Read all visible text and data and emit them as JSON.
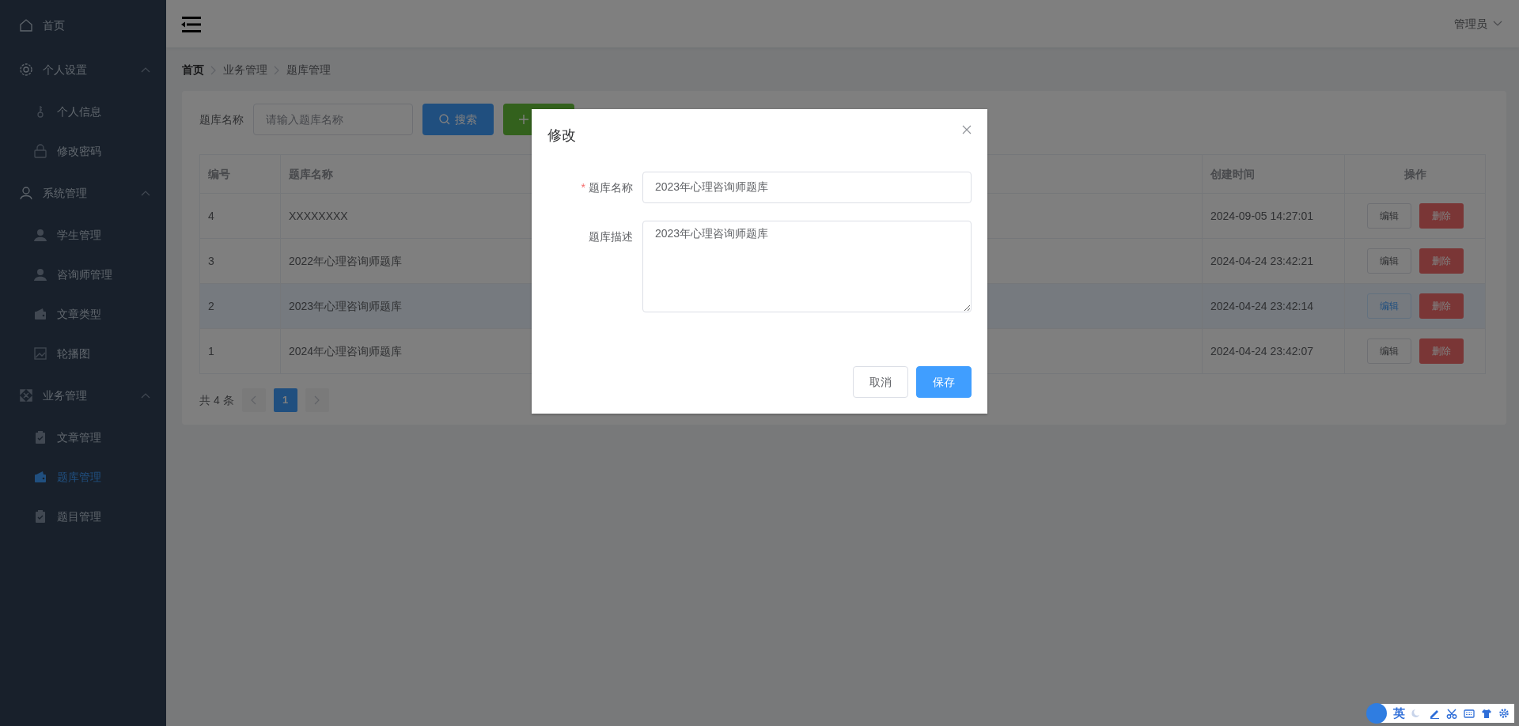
{
  "sidebar": {
    "items": [
      {
        "label": "首页",
        "selected": false
      },
      {
        "label": "个人设置",
        "expanded": true,
        "children": [
          {
            "label": "个人信息",
            "selected": false
          },
          {
            "label": "修改密码",
            "selected": false
          }
        ]
      },
      {
        "label": "系统管理",
        "expanded": true,
        "children": [
          {
            "label": "学生管理",
            "selected": false
          },
          {
            "label": "咨询师管理",
            "selected": false
          },
          {
            "label": "文章类型",
            "selected": false
          },
          {
            "label": "轮播图",
            "selected": false
          }
        ]
      },
      {
        "label": "业务管理",
        "expanded": true,
        "children": [
          {
            "label": "文章管理",
            "selected": false
          },
          {
            "label": "题库管理",
            "selected": true
          },
          {
            "label": "题目管理",
            "selected": false
          }
        ]
      }
    ]
  },
  "header": {
    "user": "管理员"
  },
  "breadcrumb": [
    {
      "label": "首页",
      "link": true
    },
    {
      "label": "业务管理",
      "link": false
    },
    {
      "label": "题库管理",
      "link": false
    }
  ],
  "search": {
    "label": "题库名称",
    "placeholder": "请输入题库名称",
    "search_button": "搜索"
  },
  "table": {
    "columns": [
      "编号",
      "题库名称",
      "创建时间",
      "操作"
    ],
    "rows": [
      {
        "id": "4",
        "name": "XXXXXXXX",
        "created": "2024-09-05 14:27:01",
        "actions": [
          "编辑",
          "删除"
        ],
        "highlighted": false
      },
      {
        "id": "3",
        "name": "2022年心理咨询师题库",
        "created": "2024-04-24 23:42:21",
        "actions": [
          "编辑",
          "删除"
        ],
        "highlighted": false
      },
      {
        "id": "2",
        "name": "2023年心理咨询师题库",
        "created": "2024-04-24 23:42:14",
        "actions": [
          "编辑",
          "删除"
        ],
        "highlighted": true
      },
      {
        "id": "1",
        "name": "2024年心理咨询师题库",
        "created": "2024-04-24 23:42:07",
        "actions": [
          "编辑",
          "删除"
        ],
        "highlighted": false
      }
    ]
  },
  "pagination": {
    "total": "共 4 条",
    "pages": [
      {
        "label": "1",
        "selected": true
      }
    ]
  },
  "dialog": {
    "title": "修改",
    "fields": [
      {
        "kind": "input",
        "label": "题库名称",
        "required_mark": "*",
        "value": "2023年心理咨询师题库"
      },
      {
        "kind": "textarea",
        "label": "题库描述",
        "value": "2023年心理咨询师题库"
      }
    ],
    "buttons": [
      {
        "label": "取消",
        "primary": false
      },
      {
        "label": "保存",
        "primary": true
      }
    ]
  },
  "ime_toolbar": {
    "mode": "英"
  }
}
